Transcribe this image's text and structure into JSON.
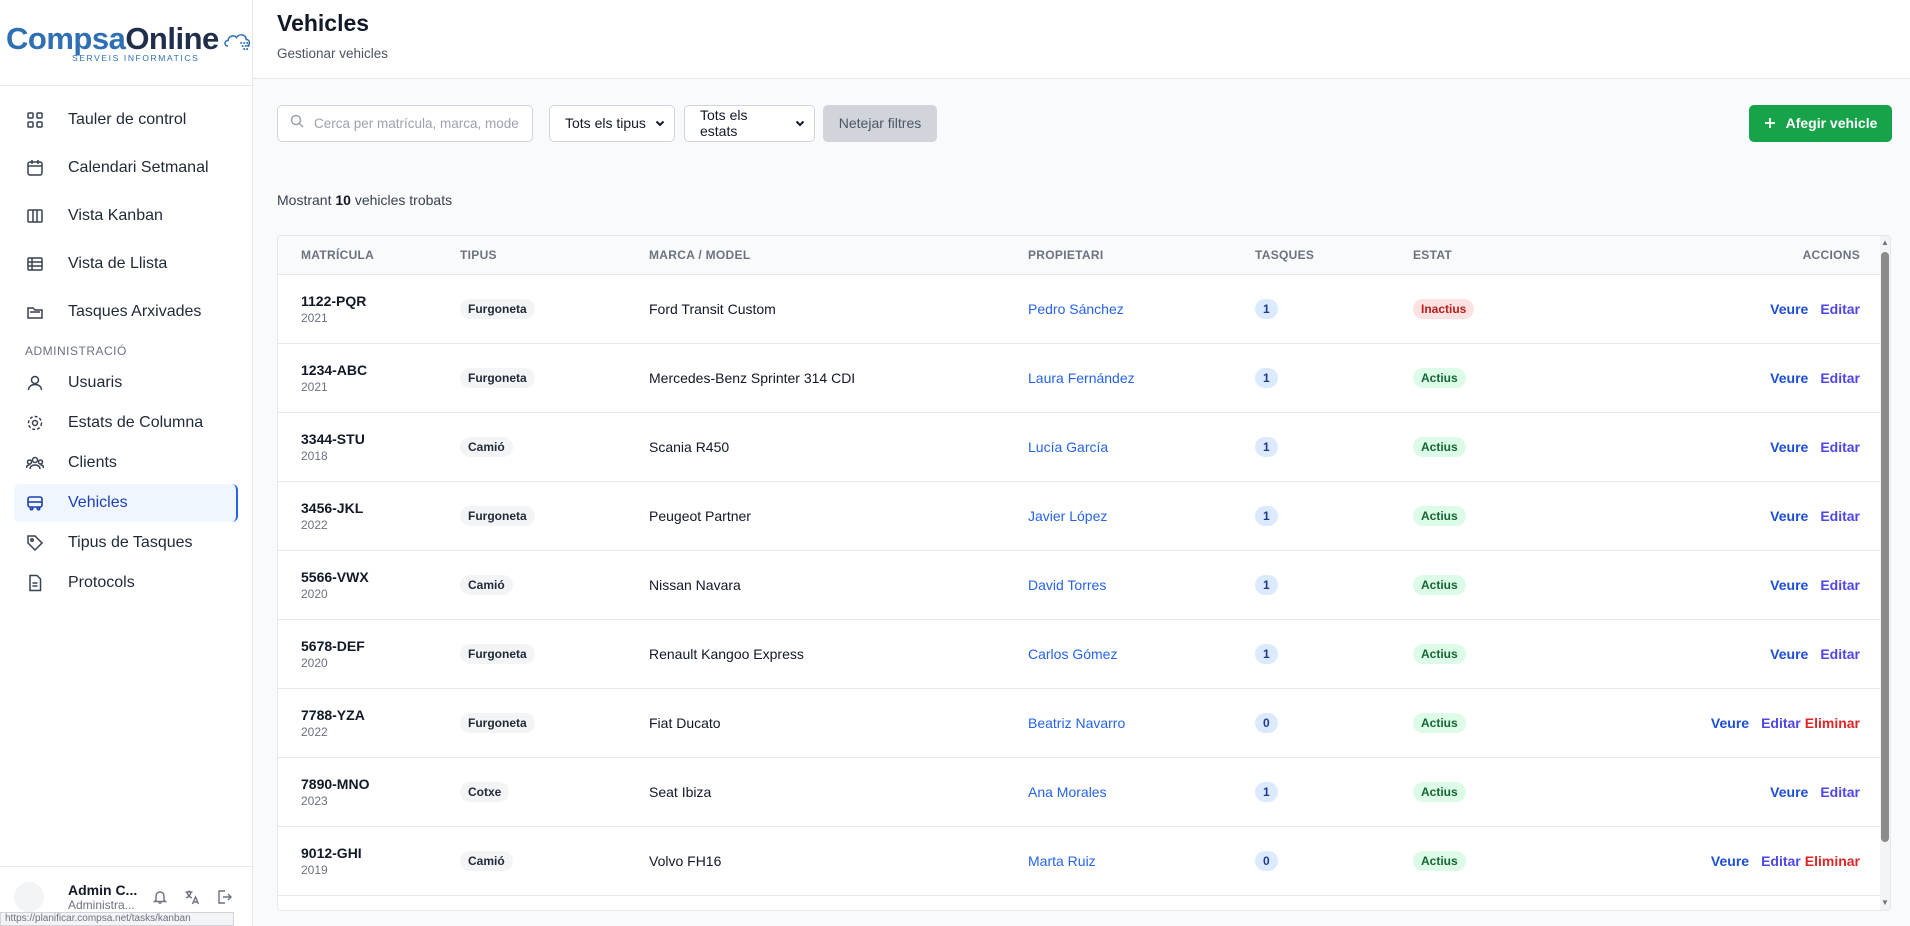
{
  "brand": {
    "name_part1": "Compsa",
    "name_part2": "Online",
    "tagline": "SERVEIS INFORMATICS"
  },
  "sidebar": {
    "items": [
      {
        "label": "Tauler de control",
        "icon": "dashboard-icon"
      },
      {
        "label": "Calendari Setmanal",
        "icon": "calendar-icon"
      },
      {
        "label": "Vista Kanban",
        "icon": "kanban-icon"
      },
      {
        "label": "Vista de Llista",
        "icon": "list-icon"
      },
      {
        "label": "Tasques Arxivades",
        "icon": "archive-folder-icon"
      }
    ],
    "admin_section": "ADMINISTRACIÓ",
    "admin_items": [
      {
        "label": "Usuaris",
        "icon": "user-icon"
      },
      {
        "label": "Estats de Columna",
        "icon": "gear-icon"
      },
      {
        "label": "Clients",
        "icon": "users-icon"
      },
      {
        "label": "Vehicles",
        "icon": "bus-icon",
        "active": true
      },
      {
        "label": "Tipus de Tasques",
        "icon": "tag-icon"
      },
      {
        "label": "Protocols",
        "icon": "document-icon"
      }
    ],
    "user": {
      "name": "Admin C...",
      "role": "Administra..."
    },
    "status_url": "https://planificar.compsa.net/tasks/kanban"
  },
  "header": {
    "title": "Vehicles",
    "subtitle": "Gestionar vehicles"
  },
  "toolbar": {
    "search_placeholder": "Cerca per matrícula, marca, model...",
    "type_filter": "Tots els tipus",
    "status_filter": "Tots els estats",
    "clear_label": "Netejar filtres",
    "add_label": "Afegir vehicle"
  },
  "summary": {
    "prefix": "Mostrant",
    "count": "10",
    "suffix": "vehicles trobats"
  },
  "table": {
    "headers": [
      "MATRÍCULA",
      "TIPUS",
      "MARCA / MODEL",
      "PROPIETARI",
      "TASQUES",
      "ESTAT",
      "ACCIONS"
    ],
    "action_labels": {
      "view": "Veure",
      "edit": "Editar",
      "delete": "Eliminar"
    },
    "rows": [
      {
        "plate": "1122-PQR",
        "year": "2021",
        "type": "Furgoneta",
        "model": "Ford Transit Custom",
        "owner": "Pedro Sánchez",
        "tasks": "1",
        "status": "Inactius",
        "status_kind": "inactiu",
        "deletable": false
      },
      {
        "plate": "1234-ABC",
        "year": "2021",
        "type": "Furgoneta",
        "model": "Mercedes-Benz Sprinter 314 CDI",
        "owner": "Laura Fernández",
        "tasks": "1",
        "status": "Actius",
        "status_kind": "actiu",
        "deletable": false
      },
      {
        "plate": "3344-STU",
        "year": "2018",
        "type": "Camió",
        "model": "Scania R450",
        "owner": "Lucía García",
        "tasks": "1",
        "status": "Actius",
        "status_kind": "actiu",
        "deletable": false
      },
      {
        "plate": "3456-JKL",
        "year": "2022",
        "type": "Furgoneta",
        "model": "Peugeot Partner",
        "owner": "Javier López",
        "tasks": "1",
        "status": "Actius",
        "status_kind": "actiu",
        "deletable": false
      },
      {
        "plate": "5566-VWX",
        "year": "2020",
        "type": "Camió",
        "model": "Nissan Navara",
        "owner": "David Torres",
        "tasks": "1",
        "status": "Actius",
        "status_kind": "actiu",
        "deletable": false
      },
      {
        "plate": "5678-DEF",
        "year": "2020",
        "type": "Furgoneta",
        "model": "Renault Kangoo Express",
        "owner": "Carlos Gómez",
        "tasks": "1",
        "status": "Actius",
        "status_kind": "actiu",
        "deletable": false
      },
      {
        "plate": "7788-YZA",
        "year": "2022",
        "type": "Furgoneta",
        "model": "Fiat Ducato",
        "owner": "Beatriz Navarro",
        "tasks": "0",
        "status": "Actius",
        "status_kind": "actiu",
        "deletable": true
      },
      {
        "plate": "7890-MNO",
        "year": "2023",
        "type": "Cotxe",
        "model": "Seat Ibiza",
        "owner": "Ana Morales",
        "tasks": "1",
        "status": "Actius",
        "status_kind": "actiu",
        "deletable": false
      },
      {
        "plate": "9012-GHI",
        "year": "2019",
        "type": "Camió",
        "model": "Volvo FH16",
        "owner": "Marta Ruiz",
        "tasks": "0",
        "status": "Actius",
        "status_kind": "actiu",
        "deletable": true
      }
    ]
  },
  "colors": {
    "primary": "#2563eb",
    "success": "#16a34a",
    "danger": "#dc2626",
    "brand_blue": "#2f6fb3"
  }
}
